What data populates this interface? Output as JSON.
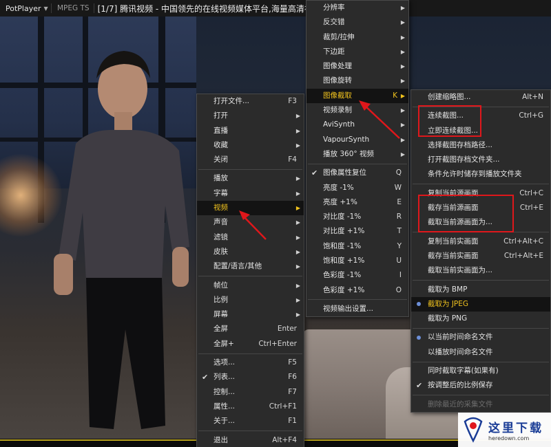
{
  "titlebar": {
    "app_name": "PotPlayer",
    "format": "MPEG TS",
    "title": "[1/7] 腾讯视频 - 中国领先的在线视频媒体平台,海量高清视频在线观看"
  },
  "main_menu": [
    {
      "label": "打开文件...",
      "shortcut": "F3"
    },
    {
      "label": "打开",
      "submenu": true
    },
    {
      "label": "直播",
      "submenu": true
    },
    {
      "label": "收藏",
      "submenu": true
    },
    {
      "label": "关闭",
      "shortcut": "F4"
    },
    {
      "separator": true
    },
    {
      "label": "播放",
      "submenu": true
    },
    {
      "label": "字幕",
      "submenu": true
    },
    {
      "label": "视频",
      "submenu": true,
      "highlighted": true
    },
    {
      "label": "声音",
      "submenu": true
    },
    {
      "label": "滤镜",
      "submenu": true
    },
    {
      "label": "皮肤",
      "submenu": true
    },
    {
      "label": "配置/语言/其他",
      "submenu": true
    },
    {
      "separator": true
    },
    {
      "label": "帧位",
      "submenu": true
    },
    {
      "label": "比例",
      "submenu": true
    },
    {
      "label": "屏幕",
      "submenu": true
    },
    {
      "label": "全屏",
      "shortcut": "Enter"
    },
    {
      "label": "全屏+",
      "shortcut": "Ctrl+Enter"
    },
    {
      "separator": true
    },
    {
      "label": "选项...",
      "shortcut": "F5"
    },
    {
      "label": "列表...",
      "shortcut": "F6",
      "checked": true
    },
    {
      "label": "控制...",
      "shortcut": "F7"
    },
    {
      "label": "属性...",
      "shortcut": "Ctrl+F1"
    },
    {
      "label": "关于...",
      "shortcut": "F1"
    },
    {
      "separator": true
    },
    {
      "label": "退出",
      "shortcut": "Alt+F4"
    }
  ],
  "video_menu": [
    {
      "label": "分辨率",
      "submenu": true
    },
    {
      "label": "反交错",
      "submenu": true
    },
    {
      "label": "裁剪/拉伸",
      "submenu": true
    },
    {
      "label": "下边距",
      "submenu": true
    },
    {
      "label": "图像处理",
      "submenu": true
    },
    {
      "label": "图像旋转",
      "submenu": true
    },
    {
      "label": "图像截取",
      "shortcut": "K",
      "submenu": true,
      "highlighted": true
    },
    {
      "label": "视频录制",
      "submenu": true
    },
    {
      "label": "AviSynth",
      "submenu": true
    },
    {
      "label": "VapourSynth",
      "submenu": true
    },
    {
      "label": "播放 360° 视频",
      "submenu": true
    },
    {
      "separator": true
    },
    {
      "label": "图像属性复位",
      "shortcut": "Q",
      "checked": true
    },
    {
      "label": "亮度 -1%",
      "shortcut": "W"
    },
    {
      "label": "亮度 +1%",
      "shortcut": "E"
    },
    {
      "label": "对比度 -1%",
      "shortcut": "R"
    },
    {
      "label": "对比度 +1%",
      "shortcut": "T"
    },
    {
      "label": "饱和度 -1%",
      "shortcut": "Y"
    },
    {
      "label": "饱和度 +1%",
      "shortcut": "U"
    },
    {
      "label": "色彩度 -1%",
      "shortcut": "I"
    },
    {
      "label": "色彩度 +1%",
      "shortcut": "O"
    },
    {
      "separator": true
    },
    {
      "label": "视频输出设置..."
    }
  ],
  "capture_menu": [
    {
      "label": "创建缩略图...",
      "shortcut": "Alt+N"
    },
    {
      "separator": true
    },
    {
      "label": "连续截图...",
      "shortcut": "Ctrl+G"
    },
    {
      "label": "立即连续截图..."
    },
    {
      "label": "选择截图存档路径..."
    },
    {
      "label": "打开截图存档文件夹..."
    },
    {
      "label": "条件允许时储存到播放文件夹"
    },
    {
      "separator": true
    },
    {
      "label": "复制当前源画面",
      "shortcut": "Ctrl+C"
    },
    {
      "label": "截存当前源画面",
      "shortcut": "Ctrl+E"
    },
    {
      "label": "截取当前源画面为..."
    },
    {
      "separator": true
    },
    {
      "label": "复制当前实画面",
      "shortcut": "Ctrl+Alt+C"
    },
    {
      "label": "截存当前实画面",
      "shortcut": "Ctrl+Alt+E"
    },
    {
      "label": "截取当前实画面为..."
    },
    {
      "separator": true
    },
    {
      "label": "截取为 BMP"
    },
    {
      "label": "截取为 JPEG",
      "radio": true,
      "highlighted": true
    },
    {
      "label": "截取为 PNG"
    },
    {
      "separator": true
    },
    {
      "label": "以当前时间命名文件",
      "radio": true
    },
    {
      "label": "以播放时间命名文件"
    },
    {
      "separator": true
    },
    {
      "label": "同时截取字幕(如果有)"
    },
    {
      "label": "按调整后的比例保存",
      "checked": true
    },
    {
      "separator": true
    },
    {
      "label": "删除最近的采集文件",
      "disabled": true
    }
  ],
  "watermark": {
    "text": "这里下载",
    "url": "heredown.com"
  },
  "colors": {
    "highlight_text": "#f0c21e",
    "annotation_red": "#e0171b",
    "radio_dot": "#6c8fd8"
  }
}
